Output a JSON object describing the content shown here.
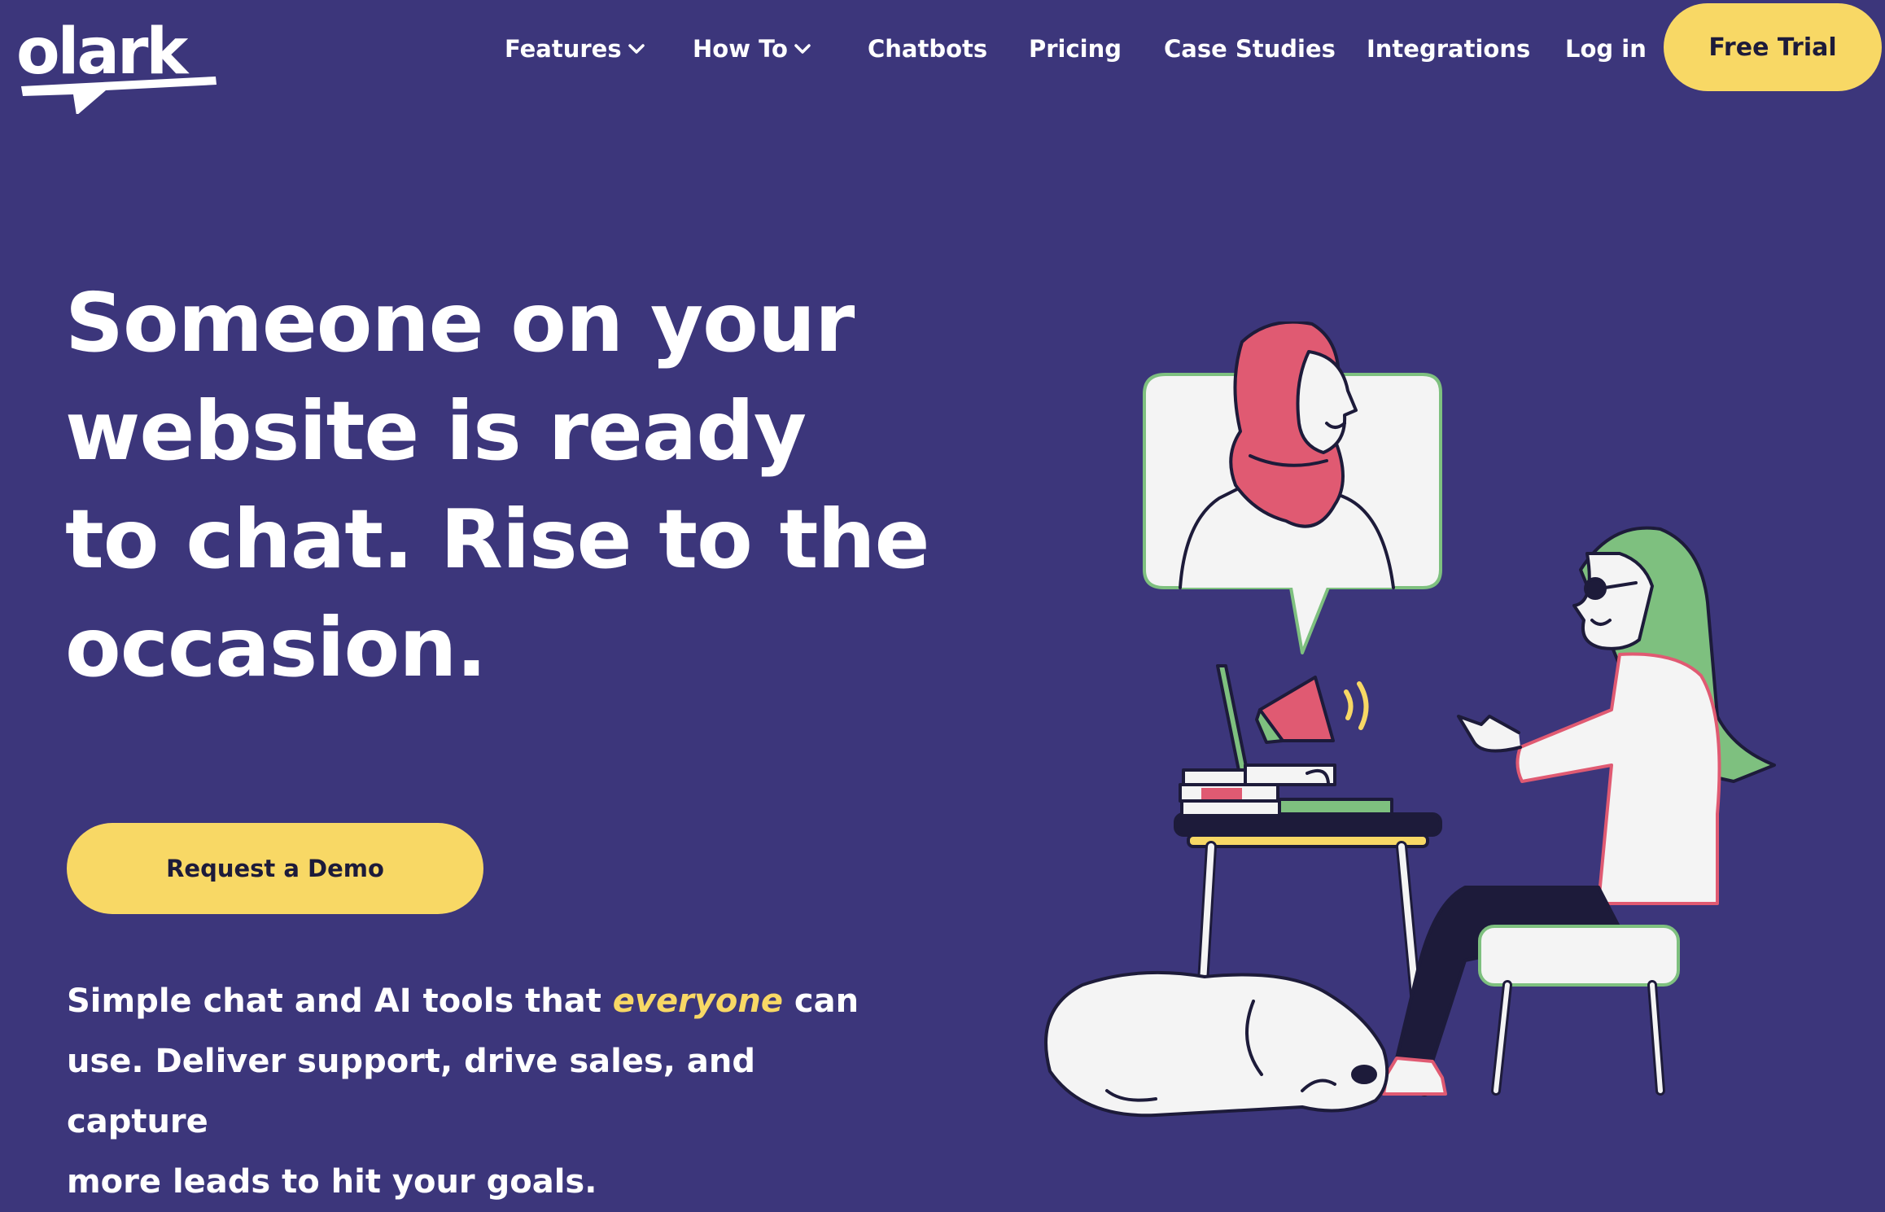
{
  "brand": {
    "logo_text": "olark"
  },
  "nav": {
    "items": [
      {
        "label": "Features",
        "has_dropdown": true
      },
      {
        "label": "How To",
        "has_dropdown": true
      },
      {
        "label": "Chatbots",
        "has_dropdown": false
      },
      {
        "label": "Pricing",
        "has_dropdown": false
      },
      {
        "label": "Case Studies",
        "has_dropdown": false
      },
      {
        "label": "Integrations",
        "has_dropdown": false
      },
      {
        "label": "Log in",
        "has_dropdown": false
      }
    ],
    "cta_label": "Free Trial"
  },
  "hero": {
    "title_lines": [
      "Someone on your",
      "website is ready",
      "to chat. Rise to the",
      "occasion."
    ],
    "demo_button_label": "Request a Demo",
    "subtitle": {
      "before": "Simple chat and AI tools that ",
      "emphasis": "everyone",
      "after_line1": " can",
      "line2": "use. Deliver support, drive sales, and capture",
      "line3": "more leads to hit your goals."
    }
  },
  "colors": {
    "background": "#3c367b",
    "accent_yellow": "#f8d865",
    "text_dark": "#1d1b3a",
    "illustration_pink": "#e05a72",
    "illustration_green": "#7ec07f"
  },
  "icons": [
    "olark-logo-icon",
    "chevron-down-icon",
    "chat-illustration"
  ]
}
